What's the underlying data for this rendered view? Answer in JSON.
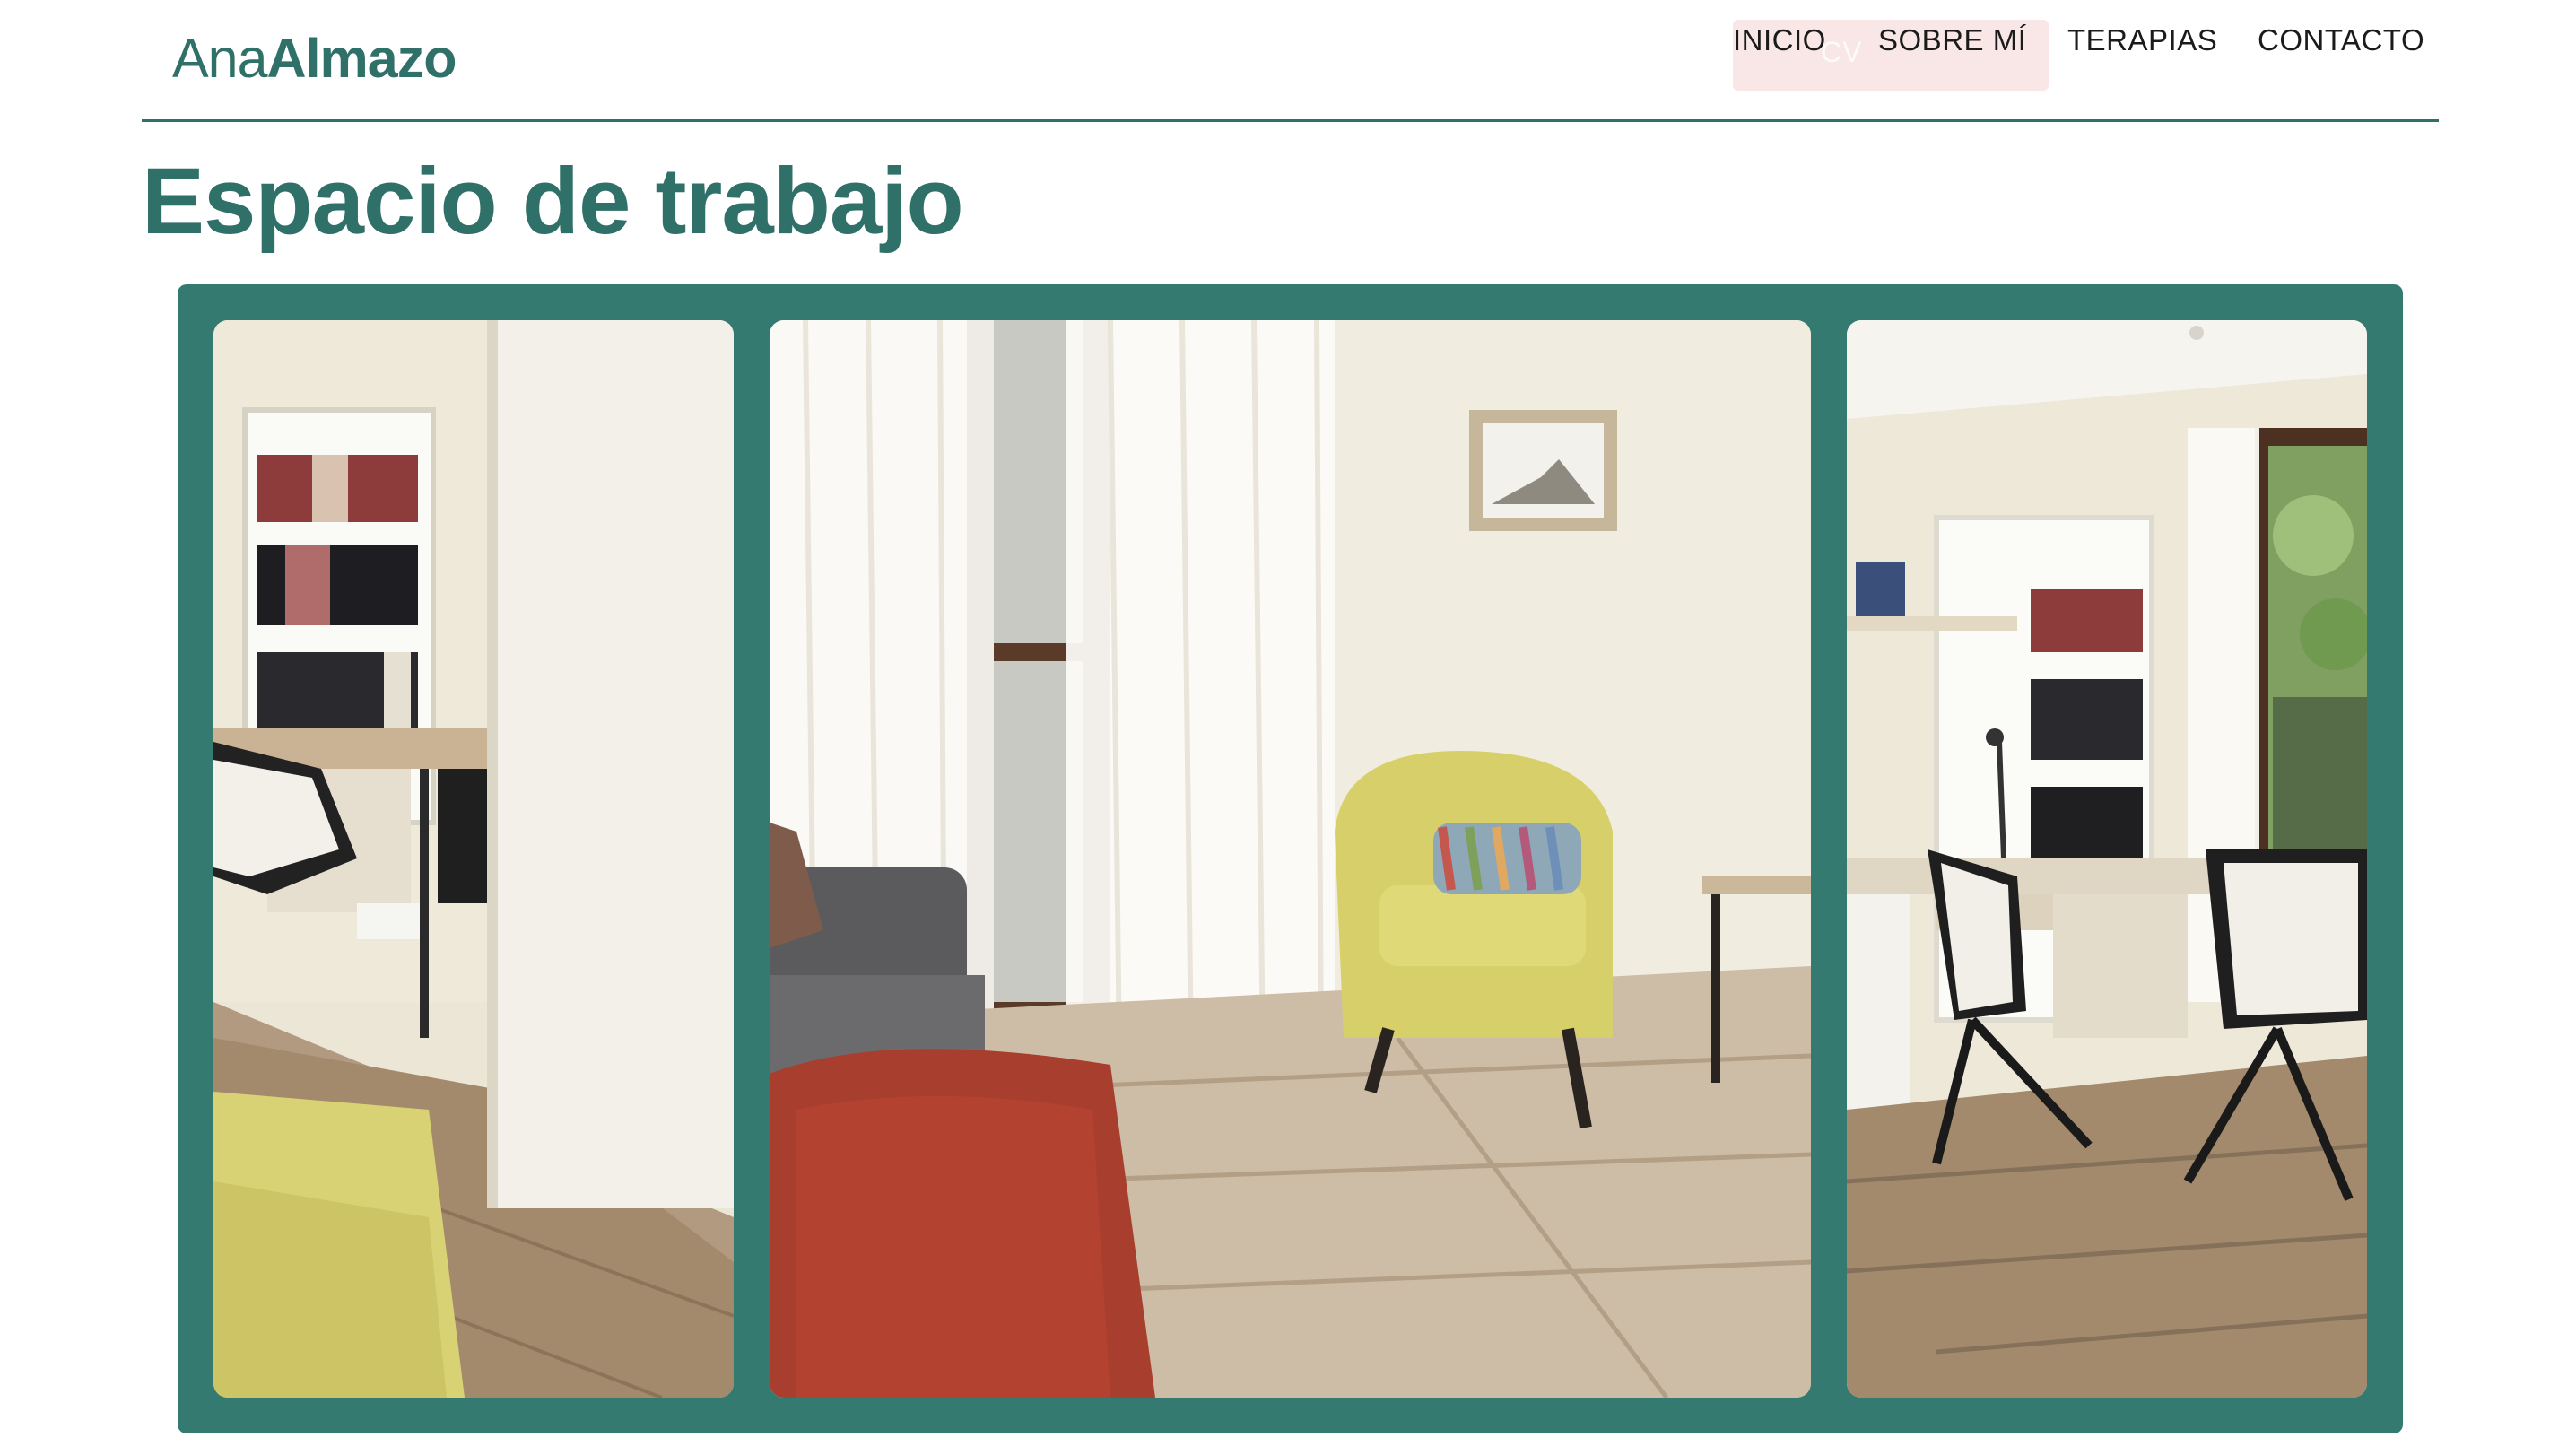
{
  "brand": {
    "name_light": "Ana",
    "name_bold": "Almazo"
  },
  "nav": {
    "items": [
      {
        "label": "INICIO"
      },
      {
        "label": "SOBRE MÍ"
      },
      {
        "label": "TERAPIAS"
      },
      {
        "label": "CONTACTO"
      }
    ],
    "ghost_label": "CV"
  },
  "main": {
    "title": "Espacio de trabajo"
  },
  "colors": {
    "brand": "#2f7068",
    "gallery_frame": "#357a71",
    "nav_highlight": "#f9e6e6"
  },
  "gallery": {
    "photos": [
      {
        "name": "office-desk-bookshelf-photo"
      },
      {
        "name": "therapy-room-armchair-photo"
      },
      {
        "name": "office-desks-window-photo"
      }
    ]
  }
}
